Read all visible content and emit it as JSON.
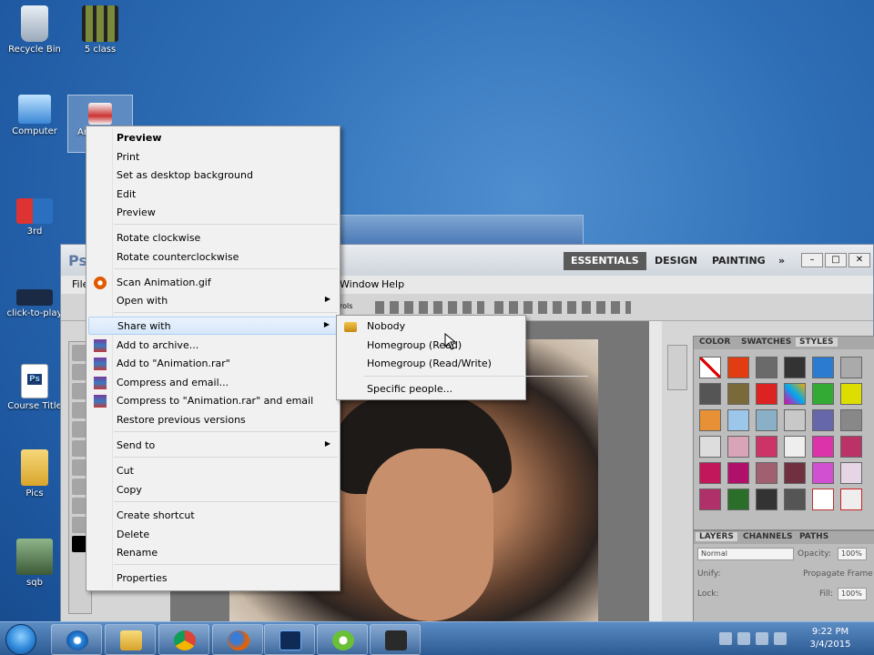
{
  "desktop_icons": [
    {
      "label": "Recycle Bin"
    },
    {
      "label": "5 class"
    },
    {
      "label": "Computer"
    },
    {
      "label": "An"
    },
    {
      "label": "3rd"
    },
    {
      "label": "click-to-play"
    },
    {
      "label": "Course Title"
    },
    {
      "label": "Pics"
    },
    {
      "label": "sqb"
    }
  ],
  "photoshop": {
    "logo": "Ps",
    "workspaces": [
      "ESSENTIALS",
      "DESIGN",
      "PAINTING",
      "»"
    ],
    "menu_visible": [
      "File",
      "Window",
      "Help"
    ],
    "options_partial_text": "rols",
    "panel_tabs": [
      "COLOR",
      "SWATCHES",
      "STYLES"
    ],
    "layers_tabs": [
      "LAYERS",
      "CHANNELS",
      "PATHS"
    ],
    "blend_mode": "Normal",
    "opacity_label": "Opacity:",
    "opacity_value": "100%",
    "unify_label": "Unify:",
    "propagate_label": "Propagate Frame",
    "lock_label": "Lock:",
    "fill_label": "Fill:",
    "fill_value": "100%"
  },
  "context_menu": {
    "items": [
      {
        "label": "Preview",
        "bold": true
      },
      {
        "label": "Print"
      },
      {
        "label": "Set as desktop background"
      },
      {
        "label": "Edit"
      },
      {
        "label": "Preview"
      },
      {
        "label": "Rotate clockwise"
      },
      {
        "label": "Rotate counterclockwise"
      },
      {
        "label": "Scan Animation.gif",
        "icon": "antivirus-icon"
      },
      {
        "label": "Open with",
        "submenu": true
      },
      {
        "label": "Share with",
        "submenu": true,
        "highlighted": true
      },
      {
        "label": "Add to archive...",
        "icon": "winrar-icon"
      },
      {
        "label": "Add to \"Animation.rar\"",
        "icon": "winrar-icon"
      },
      {
        "label": "Compress and email...",
        "icon": "winrar-icon"
      },
      {
        "label": "Compress to \"Animation.rar\" and email",
        "icon": "winrar-icon"
      },
      {
        "label": "Restore previous versions"
      },
      {
        "label": "Send to",
        "submenu": true
      },
      {
        "label": "Cut"
      },
      {
        "label": "Copy"
      },
      {
        "label": "Create shortcut"
      },
      {
        "label": "Delete"
      },
      {
        "label": "Rename"
      },
      {
        "label": "Properties"
      }
    ],
    "submenu_arrow": "▶"
  },
  "share_submenu": {
    "items": [
      {
        "label": "Nobody",
        "icon": "lock-icon"
      },
      {
        "label": "Homegroup (Read)"
      },
      {
        "label": "Homegroup (Read/Write)"
      },
      {
        "label": "Specific people..."
      }
    ]
  },
  "taskbar": {
    "time": "9:22 PM",
    "date": "3/4/2015"
  },
  "colors": {
    "desktop_blue": "#2f6fb6",
    "menu_bg": "#f1f1f1",
    "highlight": "#d5e7fb",
    "ps_accent": "#5a5a5a"
  }
}
